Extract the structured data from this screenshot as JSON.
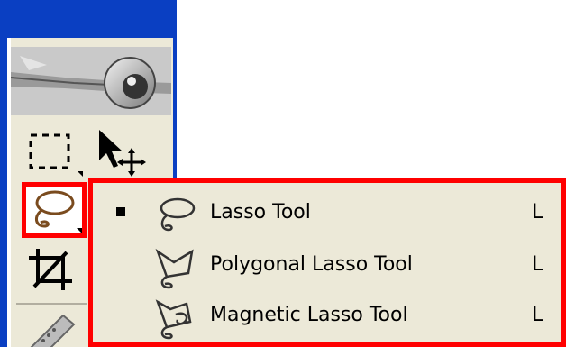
{
  "toolbox": {
    "tools": [
      {
        "name": "rectangular-marquee"
      },
      {
        "name": "move"
      },
      {
        "name": "lasso"
      },
      {
        "name": "crop"
      }
    ]
  },
  "flyout": {
    "items": [
      {
        "label": "Lasso Tool",
        "shortcut": "L",
        "selected": true,
        "icon": "lasso-icon"
      },
      {
        "label": "Polygonal Lasso Tool",
        "shortcut": "L",
        "selected": false,
        "icon": "polygonal-lasso-icon"
      },
      {
        "label": "Magnetic Lasso Tool",
        "shortcut": "L",
        "selected": false,
        "icon": "magnetic-lasso-icon"
      }
    ]
  },
  "colors": {
    "highlight": "#ff0000",
    "panel": "#ece9d8",
    "titlebar": "#0a3fc2"
  }
}
